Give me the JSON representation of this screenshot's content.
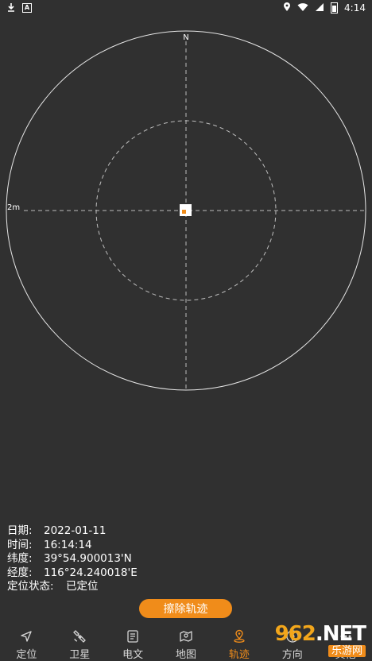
{
  "status_bar": {
    "time": "4:14",
    "left_icons": [
      "download-icon",
      "a-badge-icon"
    ],
    "right_icons": [
      "location-pin-icon",
      "wifi-icon",
      "signal-icon",
      "battery-icon"
    ]
  },
  "radar": {
    "north_label": "N",
    "scale_label": "2m",
    "colors": {
      "ring": "#e6e6e6",
      "dashed": "#bdbdbd",
      "marker_fill": "#ffffff",
      "marker_dot": "#f08c1a"
    }
  },
  "info": {
    "date_label": "日期:",
    "date_value": "2022-01-11",
    "time_label": "时间:",
    "time_value": "16:14:14",
    "lat_label": "纬度:",
    "lat_value": "39°54.900013'N",
    "lon_label": "经度:",
    "lon_value": "116°24.240018'E",
    "state_label": "定位状态:",
    "state_value": "已定位"
  },
  "erase_button": {
    "label": "擦除轨迹"
  },
  "nav": {
    "items": [
      {
        "label": "定位",
        "icon": "navigation-arrow-icon"
      },
      {
        "label": "卫星",
        "icon": "satellite-icon"
      },
      {
        "label": "电文",
        "icon": "message-list-icon"
      },
      {
        "label": "地图",
        "icon": "map-icon"
      },
      {
        "label": "轨迹",
        "icon": "track-pin-icon",
        "active": true
      },
      {
        "label": "方向",
        "icon": "compass-icon"
      },
      {
        "label": "其他",
        "icon": "more-icon"
      }
    ]
  },
  "watermark": {
    "brand": "962",
    "suffix": ".NET",
    "sub": "乐游网"
  },
  "accent_color": "#f08c1a"
}
